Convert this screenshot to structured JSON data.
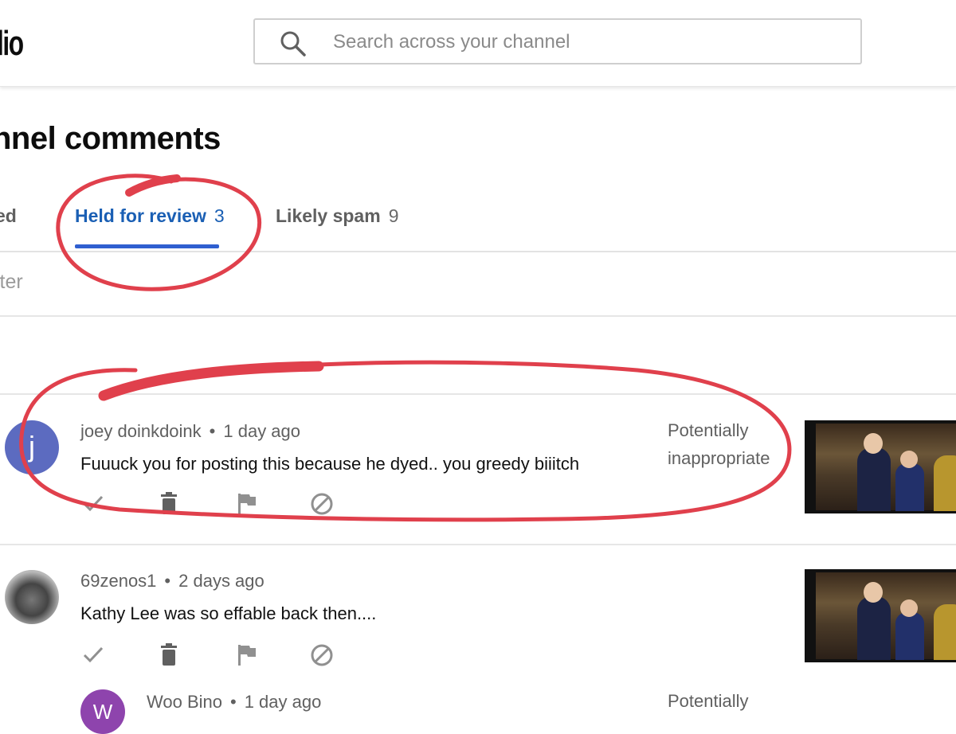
{
  "header": {
    "logo_text": "lio",
    "search_placeholder": "Search across your channel"
  },
  "page": {
    "title": "nnel comments"
  },
  "tabs": [
    {
      "label": "ed",
      "count": ""
    },
    {
      "label": "Held for review",
      "count": "3",
      "active": true
    },
    {
      "label": "Likely spam",
      "count": "9"
    }
  ],
  "filter_label": "lter",
  "comments": [
    {
      "avatar_letter": "j",
      "author": "joey doinkdoink",
      "separator": "•",
      "time": "1 day ago",
      "text": "Fuuuck you for posting this because he dyed.. you greedy biiitch",
      "status_line1": "Potentially",
      "status_line2": "inappropriate"
    },
    {
      "avatar_letter": "",
      "author": "69zenos1",
      "separator": "•",
      "time": "2 days ago",
      "text": "Kathy Lee was so effable back then....",
      "status_line1": "",
      "status_line2": ""
    },
    {
      "avatar_letter": "W",
      "author": "Woo Bino",
      "separator": "•",
      "time": "1 day ago",
      "text": "",
      "status_line1": "Potentially",
      "status_line2": ""
    }
  ],
  "icons": {
    "approve": "check-icon",
    "remove": "trash-icon",
    "report": "flag-icon",
    "hide_user": "block-icon"
  },
  "colors": {
    "active_tab": "#1a5fb4",
    "tab_underline": "#2f5fd0",
    "annotation": "#e0404c",
    "avatar_j": "#5c6bc0",
    "avatar_w": "#8e44ad"
  }
}
